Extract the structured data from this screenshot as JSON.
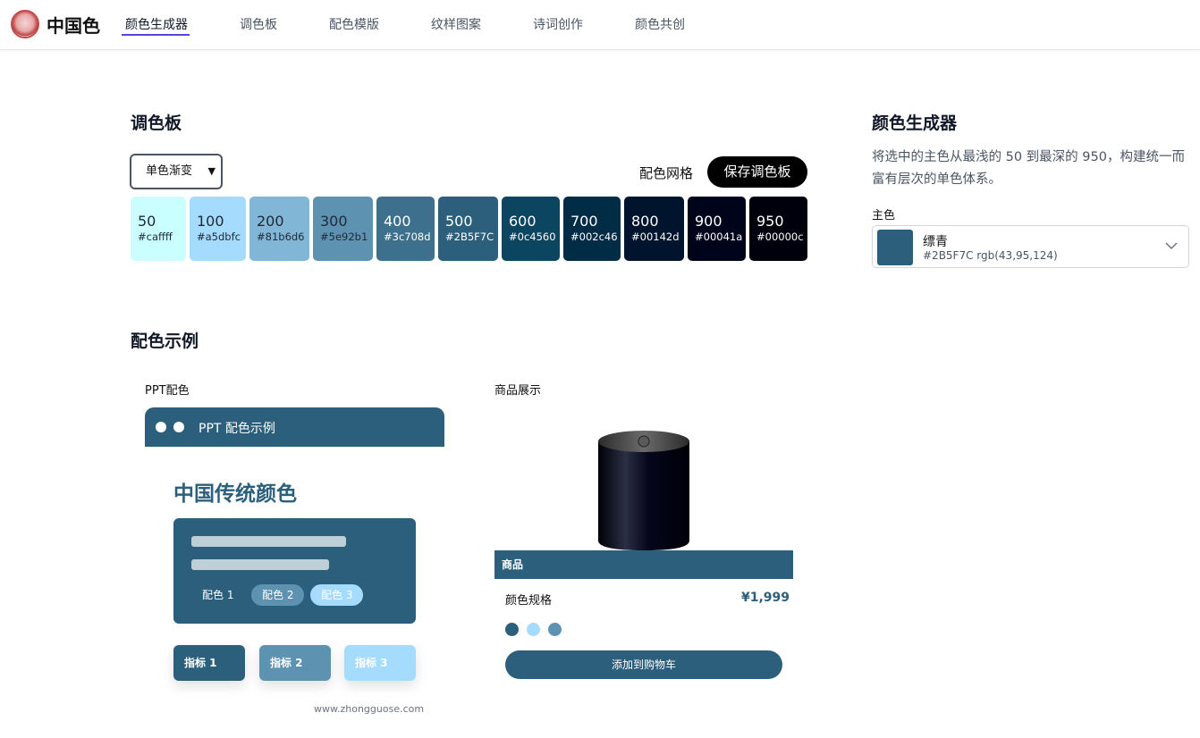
{
  "header": {
    "brand": "中国色",
    "nav": [
      "颜色生成器",
      "调色板",
      "配色模版",
      "纹样图案",
      "诗词创作",
      "颜色共创"
    ]
  },
  "palette": {
    "title": "调色板",
    "mode_select": "单色渐变",
    "grid_link": "配色网格",
    "save_label": "保存调色板",
    "swatches": [
      {
        "name": "50",
        "hex": "#caffff",
        "color": "#caffff",
        "text_color": "#1f2937"
      },
      {
        "name": "100",
        "hex": "#a5dbfc",
        "color": "#a5dbfc",
        "text_color": "#1f2937"
      },
      {
        "name": "200",
        "hex": "#81b6d6",
        "color": "#81b6d6",
        "text_color": "#1f2937"
      },
      {
        "name": "300",
        "hex": "#5e92b1",
        "color": "#5e92b1",
        "text_color": "#1f2937"
      },
      {
        "name": "400",
        "hex": "#3c708d",
        "color": "#3c708d",
        "text_color": "#ffffff"
      },
      {
        "name": "500",
        "hex": "#2B5F7C",
        "color": "#2b5f7c",
        "text_color": "#ffffff"
      },
      {
        "name": "600",
        "hex": "#0c4560",
        "color": "#0c4560",
        "text_color": "#ffffff"
      },
      {
        "name": "700",
        "hex": "#002c46",
        "color": "#002c46",
        "text_color": "#ffffff"
      },
      {
        "name": "800",
        "hex": "#00142d",
        "color": "#00142d",
        "text_color": "#ffffff"
      },
      {
        "name": "900",
        "hex": "#00041a",
        "color": "#00041a",
        "text_color": "#ffffff"
      },
      {
        "name": "950",
        "hex": "#00000c",
        "color": "#00000c",
        "text_color": "#ffffff"
      }
    ]
  },
  "generator": {
    "title": "颜色生成器",
    "description": "将选中的主色从最浅的 50 到最深的 950，构建统一而富有层次的单色体系。",
    "main_color_label": "主色",
    "selected_name": "缥青",
    "selected_info": "#2B5F7C rgb(43,95,124)",
    "selected_color": "#2b5f7c"
  },
  "examples": {
    "title": "配色示例",
    "ppt": {
      "label": "PPT配色",
      "header_title": "PPT 配色示例",
      "big_title": "中国传统颜色",
      "pills": [
        "配色 1",
        "配色 2",
        "配色 3"
      ],
      "metrics": [
        "指标 1",
        "指标 2",
        "指标 3"
      ],
      "watermark": "www.zhongguose.com"
    },
    "product": {
      "label": "商品展示",
      "bar_label": "商品",
      "spec_label": "颜色规格",
      "price": "¥1,999",
      "cart_label": "添加到购物车",
      "option_colors": [
        "#2b5f7c",
        "#a5dbfc",
        "#5e92b1"
      ]
    }
  },
  "colors": {
    "primary": "#2b5f7c",
    "primary_300": "#5e92b1",
    "primary_100": "#a5dbfc",
    "dark_950": "#00000c"
  }
}
